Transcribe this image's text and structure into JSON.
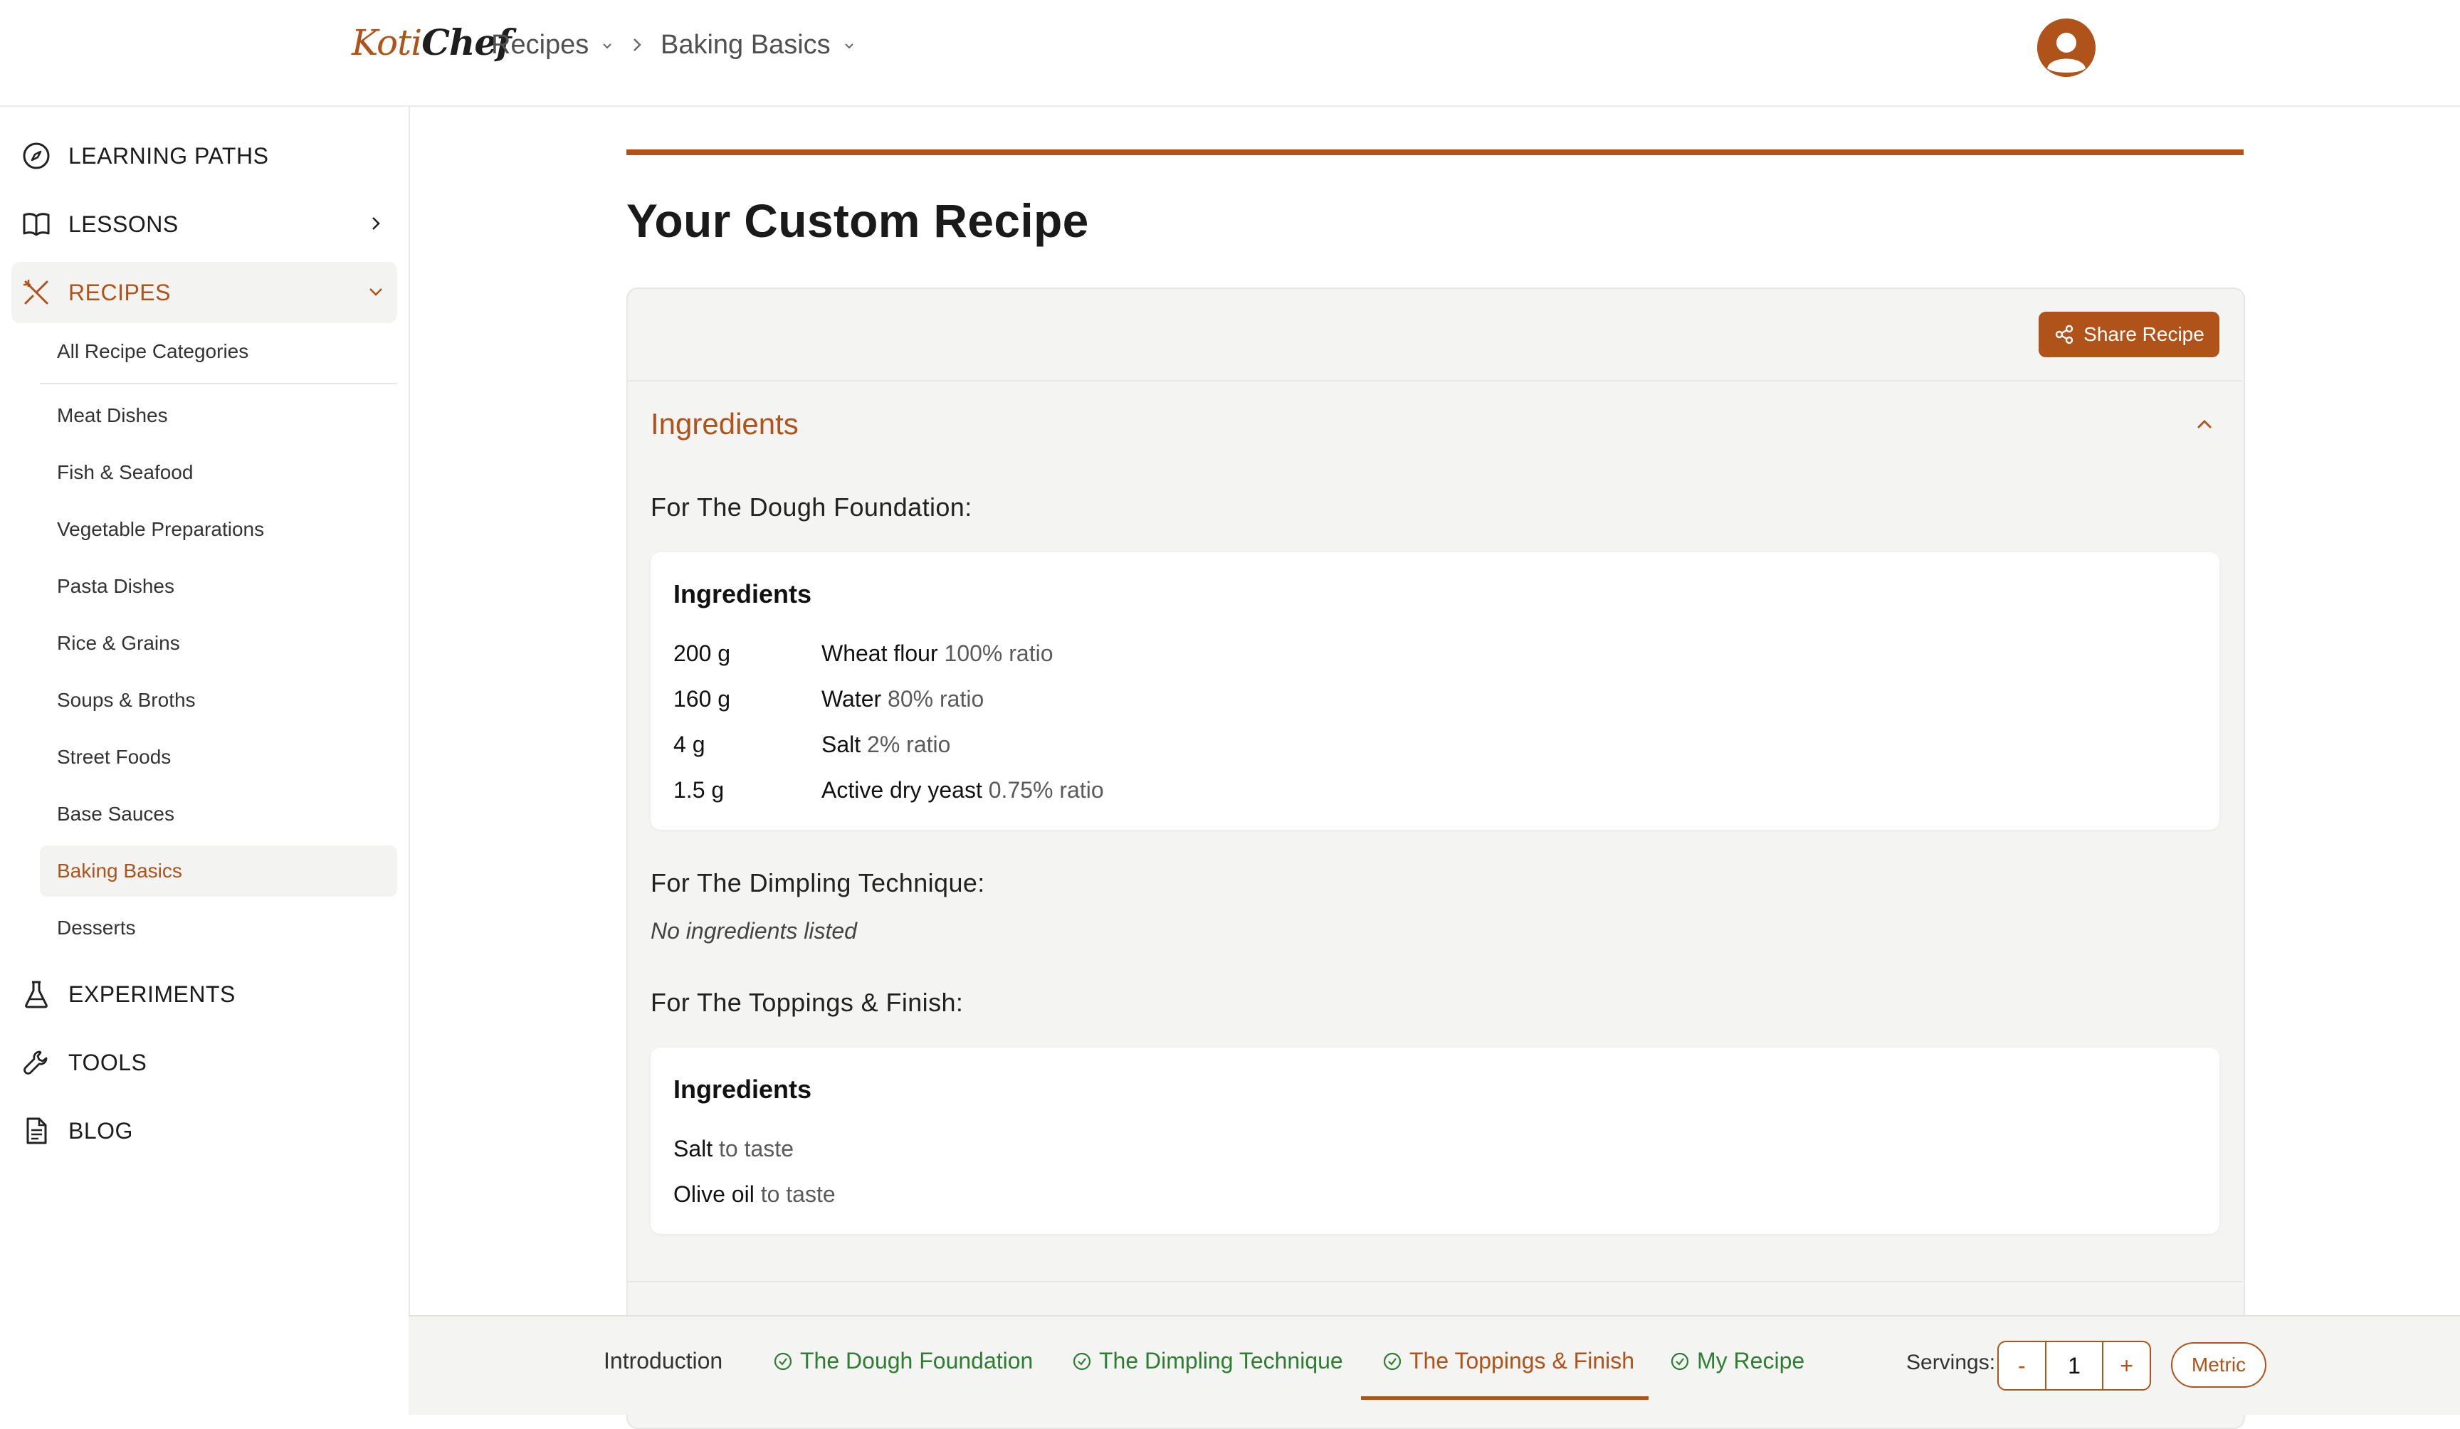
{
  "header": {
    "logo_part1": "Koti",
    "logo_part2": "Chef",
    "breadcrumb": [
      {
        "label": "Recipes"
      },
      {
        "label": "Baking Basics"
      }
    ]
  },
  "sidebar": {
    "items": [
      {
        "label": "LEARNING PATHS",
        "icon": "compass-icon"
      },
      {
        "label": "LESSONS",
        "icon": "book-icon"
      },
      {
        "label": "RECIPES",
        "icon": "utensils-icon"
      },
      {
        "label": "EXPERIMENTS",
        "icon": "flask-icon"
      },
      {
        "label": "TOOLS",
        "icon": "wrench-icon"
      },
      {
        "label": "BLOG",
        "icon": "document-icon"
      }
    ],
    "recipe_categories": [
      "All Recipe Categories",
      "Meat Dishes",
      "Fish & Seafood",
      "Vegetable Preparations",
      "Pasta Dishes",
      "Rice & Grains",
      "Soups & Broths",
      "Street Foods",
      "Base Sauces",
      "Baking Basics",
      "Desserts"
    ],
    "active_category": "Baking Basics"
  },
  "main": {
    "title": "Your Custom Recipe",
    "share_label": "Share Recipe",
    "accordion_title": "Ingredients",
    "sections": [
      {
        "heading": "For The Dough Foundation:",
        "card_title": "Ingredients",
        "ingredients": [
          {
            "qty": "200 g",
            "name": "Wheat flour",
            "note": "100% ratio"
          },
          {
            "qty": "160 g",
            "name": "Water",
            "note": "80% ratio"
          },
          {
            "qty": "4 g",
            "name": "Salt",
            "note": "2% ratio"
          },
          {
            "qty": "1.5 g",
            "name": "Active dry yeast",
            "note": "0.75% ratio"
          }
        ]
      },
      {
        "heading": "For The Dimpling Technique:",
        "empty_text": "No ingredients listed"
      },
      {
        "heading": "For The Toppings & Finish:",
        "card_title": "Ingredients",
        "ingredients": [
          {
            "name": "Salt",
            "note": "to taste"
          },
          {
            "name": "Olive oil",
            "note": "to taste"
          }
        ]
      }
    ]
  },
  "bottom_bar": {
    "tabs": [
      {
        "label": "Introduction",
        "state": "default"
      },
      {
        "label": "The Dough Foundation",
        "state": "done"
      },
      {
        "label": "The Dimpling Technique",
        "state": "done"
      },
      {
        "label": "The Toppings & Finish",
        "state": "active"
      },
      {
        "label": "My Recipe",
        "state": "done"
      }
    ],
    "servings_label": "Servings:",
    "servings_minus": "-",
    "servings_value": "1",
    "servings_plus": "+",
    "unit_label": "Metric"
  },
  "colors": {
    "accent": "#b0531a",
    "done_green": "#2e7d32",
    "panel_bg": "#f4f4f2"
  }
}
